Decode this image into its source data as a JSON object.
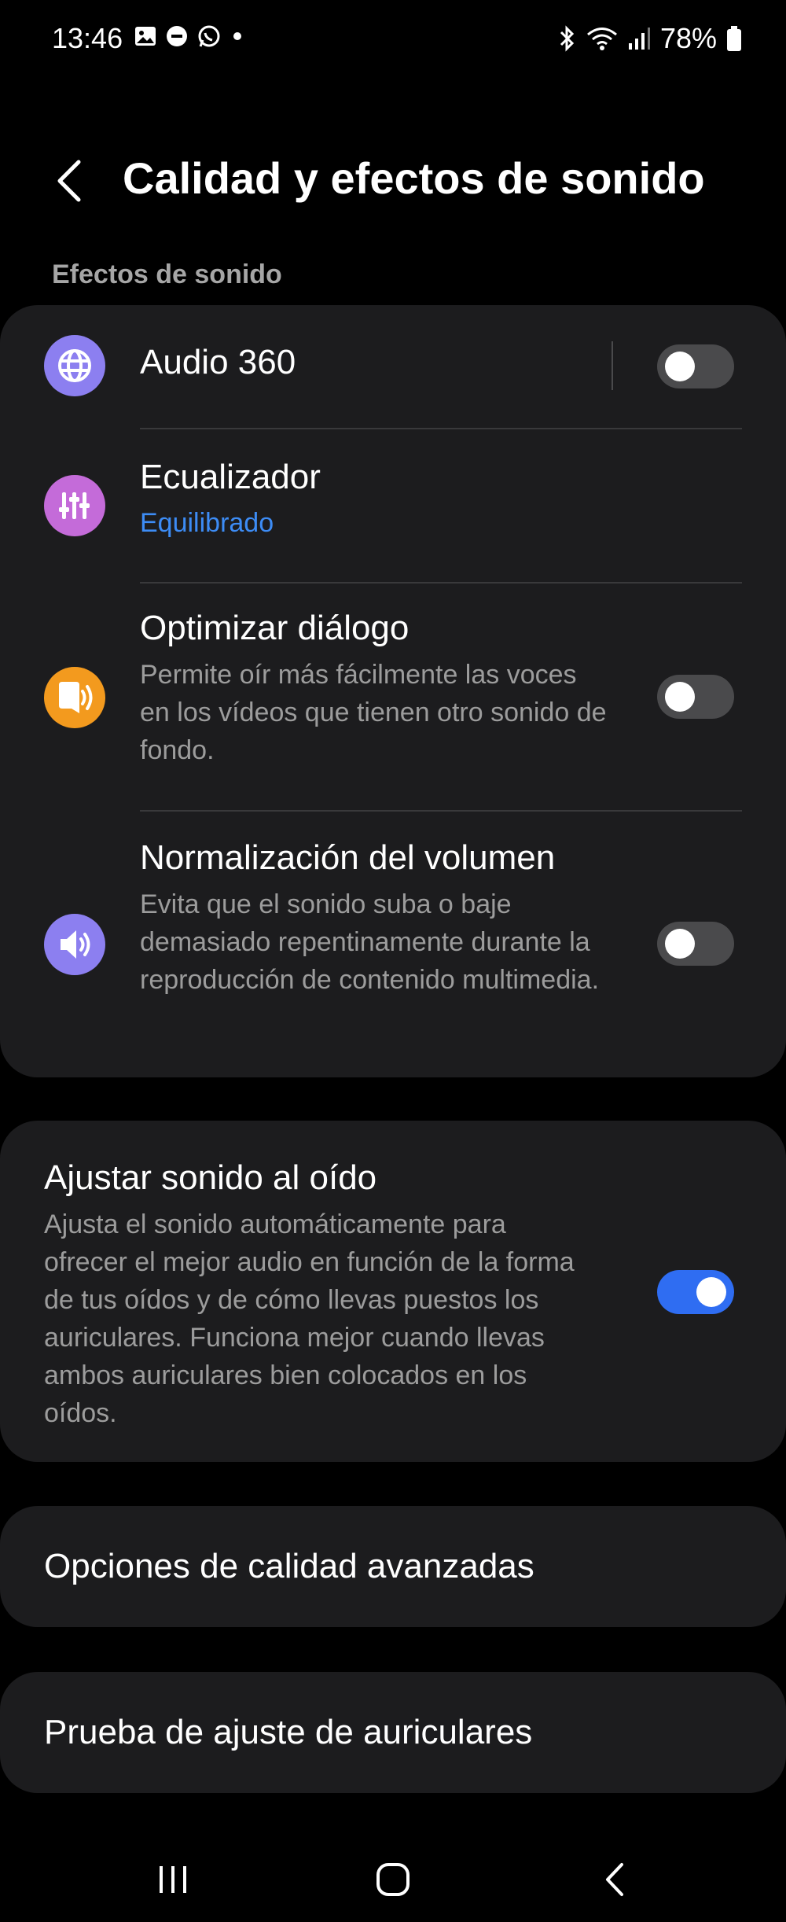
{
  "status_bar": {
    "time": "13:46",
    "battery": "78%"
  },
  "header": {
    "title": "Calidad y efectos de sonido"
  },
  "section_label": "Efectos de sonido",
  "effects": {
    "audio360": {
      "title": "Audio 360",
      "enabled": false,
      "icon": "globe-icon",
      "icon_color": "#8c7ff0"
    },
    "equalizer": {
      "title": "Ecualizador",
      "value": "Equilibrado",
      "icon": "sliders-icon",
      "icon_color": "#c46bd9"
    },
    "dialog": {
      "title": "Optimizar diálogo",
      "description": "Permite oír más fácilmente las voces en los vídeos que tienen otro sonido de fondo.",
      "enabled": false,
      "icon": "speech-icon",
      "icon_color": "#f39a1e"
    },
    "normalization": {
      "title": "Normalización del volumen",
      "description": "Evita que el sonido suba o baje demasiado repentinamente durante la reproducción de contenido multimedia.",
      "enabled": false,
      "icon": "speaker-icon",
      "icon_color": "#8c7ff0"
    }
  },
  "adapt": {
    "title": "Ajustar sonido al oído",
    "description": "Ajusta el sonido automáticamente para ofrecer el mejor audio en función de la forma de tus oídos y de cómo llevas puestos los auriculares. Funciona mejor cuando llevas ambos auriculares bien colocados en los oídos.",
    "enabled": true
  },
  "advanced_quality": {
    "title": "Opciones de calidad avanzadas"
  },
  "fit_test": {
    "title": "Prueba de ajuste de auriculares"
  },
  "colors": {
    "background": "#000000",
    "card": "#1c1c1e",
    "accent": "#2f6df2",
    "link": "#3d8cf5"
  }
}
